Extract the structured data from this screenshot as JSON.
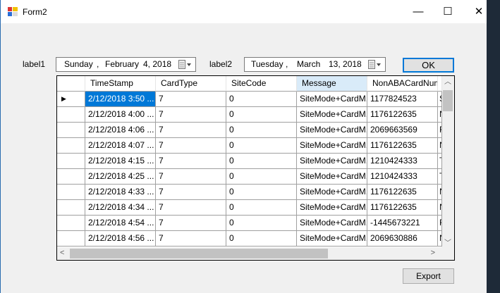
{
  "window": {
    "title": "Form2",
    "minimize": "—",
    "maximize": "☐",
    "close": "✕"
  },
  "form": {
    "label1": "label1",
    "label2": "label2",
    "date1": {
      "day": "Sunday",
      "sep": ",",
      "month": "February",
      "date": "4, 2018"
    },
    "date2": {
      "day": "Tuesday",
      "sep": ",",
      "month": "March",
      "date": "13, 2018"
    },
    "ok_label": "OK",
    "export_label": "Export"
  },
  "grid": {
    "columns": [
      "TimeStamp",
      "CardType",
      "SiteCode",
      "Message",
      "NonABACardNumb",
      ""
    ],
    "rows": [
      [
        "2/12/2018 3:50 ...",
        "7",
        "0",
        "SiteMode+CardM...",
        "1177824523",
        "S"
      ],
      [
        "2/12/2018 4:00 ...",
        "7",
        "0",
        "SiteMode+CardM...",
        "1176122635",
        "N"
      ],
      [
        "2/12/2018 4:06 ...",
        "7",
        "0",
        "SiteMode+CardM...",
        "2069663569",
        "F"
      ],
      [
        "2/12/2018 4:07 ...",
        "7",
        "0",
        "SiteMode+CardM...",
        "1176122635",
        "N"
      ],
      [
        "2/12/2018 4:15 ...",
        "7",
        "0",
        "SiteMode+CardM...",
        "1210424333",
        "T"
      ],
      [
        "2/12/2018 4:25 ...",
        "7",
        "0",
        "SiteMode+CardM...",
        "1210424333",
        "T"
      ],
      [
        "2/12/2018 4:33 ...",
        "7",
        "0",
        "SiteMode+CardM...",
        "1176122635",
        "N"
      ],
      [
        "2/12/2018 4:34 ...",
        "7",
        "0",
        "SiteMode+CardM...",
        "1176122635",
        "N"
      ],
      [
        "2/12/2018 4:54 ...",
        "7",
        "0",
        "SiteMode+CardM...",
        "-1445673221",
        "F"
      ],
      [
        "2/12/2018 4:56 ...",
        "7",
        "0",
        "SiteMode+CardM...",
        "2069630886",
        "N"
      ]
    ]
  }
}
